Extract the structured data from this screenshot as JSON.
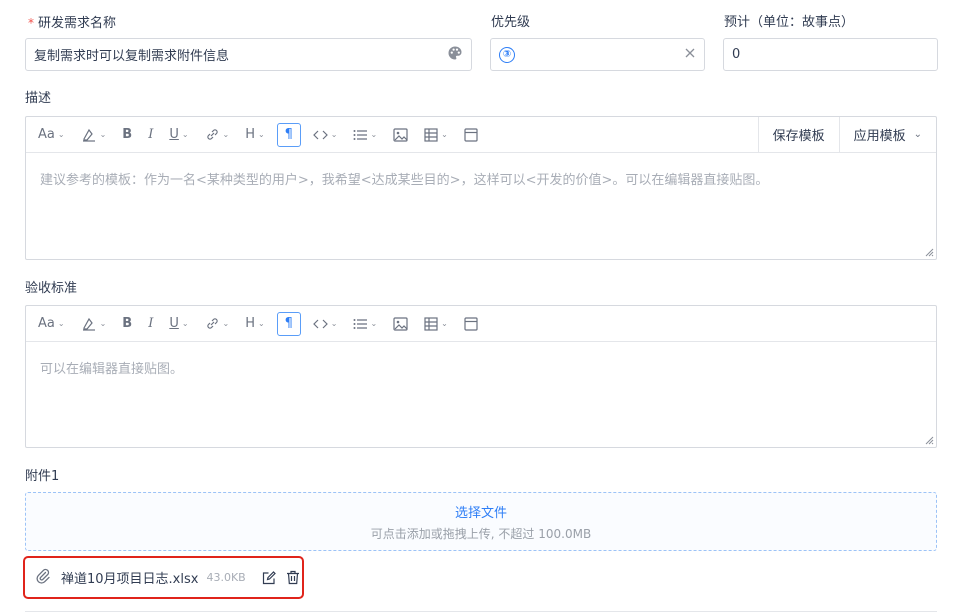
{
  "form": {
    "name_label": "研发需求名称",
    "name_required_mark": "*",
    "name_value": "复制需求时可以复制需求附件信息",
    "priority_label": "优先级",
    "priority_value": "③",
    "estimate_label": "预计（单位：故事点）",
    "estimate_value": "0"
  },
  "description": {
    "label": "描述",
    "toolbar": {
      "font": "Aa",
      "save_template": "保存模板",
      "apply_template": "应用模板"
    },
    "placeholder": "建议参考的模板：作为一名<某种类型的用户>，我希望<达成某些目的>，这样可以<开发的价值>。可以在编辑器直接贴图。"
  },
  "acceptance": {
    "label": "验收标准",
    "toolbar": {
      "font": "Aa"
    },
    "placeholder": "可以在编辑器直接贴图。"
  },
  "attachments": {
    "label": "附件1",
    "select_button": "选择文件",
    "hint": "可点击添加或拖拽上传, 不超过 100.0MB",
    "files": [
      {
        "name": "禅道10月项目日志.xlsx",
        "size": "43.0KB"
      }
    ]
  },
  "colors": {
    "accent": "#2e7ef6",
    "required": "#f1514b",
    "highlight_border": "#e0241b"
  }
}
